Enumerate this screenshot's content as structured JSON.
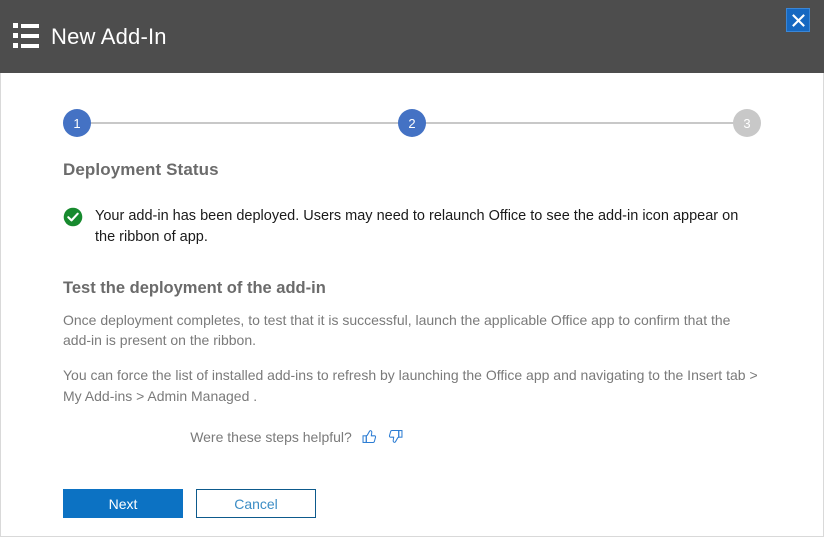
{
  "header": {
    "title": "New Add-In",
    "icon": "list-icon",
    "background_color": "#4d4d4d",
    "close_label": "X",
    "close_icon": "close-icon",
    "close_color": "#1668c1"
  },
  "stepper": {
    "steps": [
      {
        "number": "1",
        "state": "active"
      },
      {
        "number": "2",
        "state": "active"
      },
      {
        "number": "3",
        "state": "inactive"
      }
    ],
    "active_color": "#4472c4",
    "inactive_color": "#c8c8c8"
  },
  "main": {
    "section_title": "Deployment Status",
    "status": {
      "icon": "check-circle-icon",
      "icon_color": "#178a2e",
      "message": "Your add-in has been deployed. Users may need to relaunch Office to see the add-in icon appear on the ribbon of app."
    },
    "test_section": {
      "heading": "Test the deployment of the add-in",
      "paragraph_1": "Once deployment completes, to test that it is successful, launch the applicable Office app to confirm that the add-in is present on the ribbon.",
      "paragraph_2": "You can force the list of installed add-ins to refresh by launching the Office app and navigating to the Insert tab > My Add-ins > Admin Managed ."
    },
    "feedback": {
      "question": "Were these steps helpful?",
      "thumbs_up_icon": "thumbs-up-icon",
      "thumbs_down_icon": "thumbs-down-icon",
      "icon_color": "#2b7cd3"
    }
  },
  "footer": {
    "next_label": "Next",
    "cancel_label": "Cancel",
    "primary_color": "#0c72c3"
  }
}
